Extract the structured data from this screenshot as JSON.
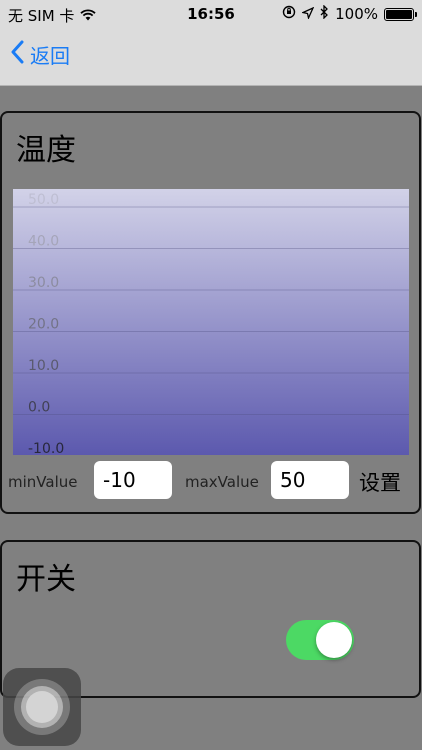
{
  "status_bar": {
    "carrier": "无 SIM 卡",
    "time": "16:56",
    "battery": "100%",
    "battery_level": 1.0
  },
  "nav": {
    "back_label": "返回"
  },
  "temperature": {
    "title": "温度",
    "min_label": "minValue",
    "min_value": "-10",
    "max_label": "maxValue",
    "max_value": "50",
    "settings_label": "设置"
  },
  "chart_data": {
    "type": "area",
    "ylim": [
      -10,
      50
    ],
    "y_ticks": [
      "50.0",
      "40.0",
      "30.0",
      "20.0",
      "10.0",
      "0.0",
      "-10.0"
    ],
    "tick_values": [
      50,
      40,
      30,
      20,
      10,
      0,
      -10
    ],
    "grid": true,
    "gradient_top": "#d2d2e8",
    "gradient_bottom": "#5c59ae"
  },
  "switch_section": {
    "title": "开关",
    "toggle_on": true,
    "toggle_color": "#4cd964"
  },
  "icons": {
    "back": "chevron-left-icon",
    "wifi": "wifi-icon",
    "location": "location-arrow-icon",
    "bluetooth": "bluetooth-icon",
    "rotation_lock": "rotation-lock-icon",
    "battery": "battery-icon",
    "assistive_touch": "assistive-touch-icon"
  }
}
